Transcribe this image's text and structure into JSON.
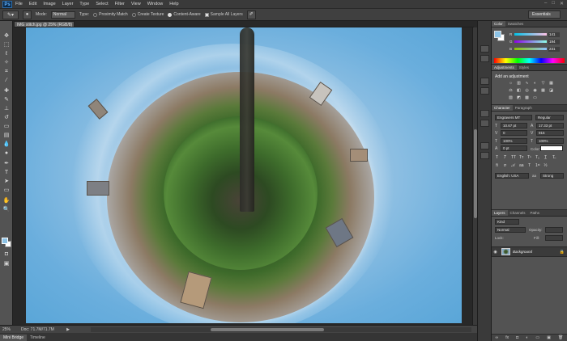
{
  "app": {
    "logo": "Ps"
  },
  "menu": [
    "File",
    "Edit",
    "Image",
    "Layer",
    "Type",
    "Select",
    "Filter",
    "View",
    "Window",
    "Help"
  ],
  "window_controls": [
    "–",
    "□",
    "✕"
  ],
  "options": {
    "mode_label": "Mode:",
    "mode_value": "Normal",
    "type_label": "Type:",
    "radio_proximity": "Proximity Match",
    "radio_texture": "Create Texture",
    "radio_content": "Content-Aware",
    "sample_all": "Sample All Layers",
    "workspace": "Essentials"
  },
  "document": {
    "tab_title": "IMG stitch.jpg @ 25% (RGB/8) *",
    "zoom": "25%",
    "doc_size": "Doc: 71.7M/71.7M"
  },
  "bottom_tabs": [
    "Mini Bridge",
    "Timeline"
  ],
  "color_panel": {
    "tabs": [
      "Color",
      "Swatches"
    ],
    "r_label": "R",
    "r_value": "141",
    "g_label": "G",
    "g_value": "194",
    "b_label": "B",
    "b_value": "231"
  },
  "adjustments": {
    "tabs": [
      "Adjustments",
      "Styles"
    ],
    "title": "Add an adjustment"
  },
  "character": {
    "tabs": [
      "Character",
      "Paragraph"
    ],
    "font": "Engravers MT",
    "style": "Regular",
    "size": "10.67 pt",
    "leading": "17.33 pt",
    "kerning": "0",
    "tracking": "915",
    "vscale": "100%",
    "hscale": "100%",
    "baseline": "0 pt",
    "color_label": "Color:",
    "language": "English: USA",
    "aa_label": "aa",
    "antialias": "Strong"
  },
  "layers": {
    "tabs": [
      "Layers",
      "Channels",
      "Paths"
    ],
    "kind": "Kind",
    "blend": "Normal",
    "opacity_label": "Opacity:",
    "lock_label": "Lock:",
    "fill_label": "Fill:",
    "layer_name": "Background"
  },
  "colors": {
    "foreground": "#8dc3e6",
    "background": "#ffffff",
    "ui_dark": "#282828",
    "panel": "#535353"
  },
  "icons": [
    "move-icon",
    "marquee-icon",
    "lasso-icon",
    "quick-select-icon",
    "crop-icon",
    "eyedropper-icon",
    "healing-icon",
    "brush-icon",
    "stamp-icon",
    "history-brush-icon",
    "eraser-icon",
    "gradient-icon",
    "blur-icon",
    "dodge-icon",
    "pen-icon",
    "type-icon",
    "path-select-icon",
    "shape-icon",
    "hand-icon",
    "zoom-icon"
  ]
}
